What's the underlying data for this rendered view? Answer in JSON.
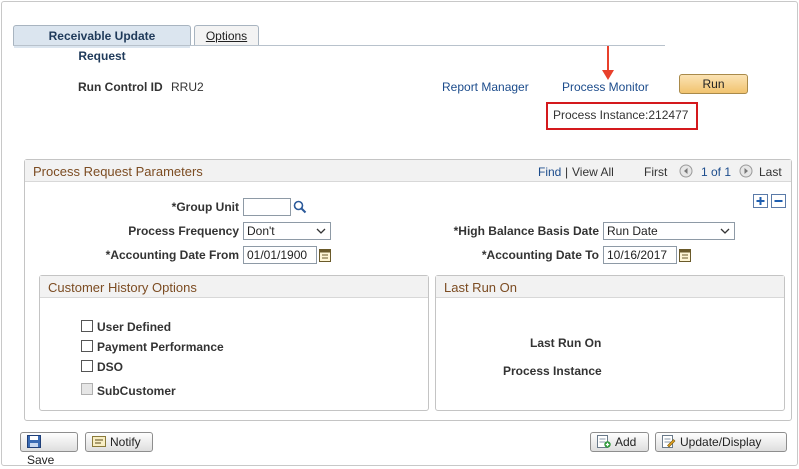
{
  "tabs": [
    {
      "label": "Receivable Update Request",
      "active": true
    },
    {
      "label": "Options",
      "active": false
    }
  ],
  "header": {
    "run_control_label": "Run Control ID",
    "run_control_value": "RRU2",
    "report_manager": "Report Manager",
    "process_monitor": "Process Monitor",
    "run_button": "Run",
    "process_instance": "Process Instance:212477"
  },
  "params": {
    "title": "Process Request Parameters",
    "find": "Find",
    "separator": "|",
    "view_all": "View All",
    "first": "First",
    "page_range": "1 of 1",
    "last": "Last",
    "group_unit_label": "*Group Unit",
    "group_unit_value": "",
    "process_frequency_label": "Process Frequency",
    "process_frequency_value": "Don't",
    "high_balance_label": "*High Balance Basis Date",
    "high_balance_value": "Run Date",
    "acct_date_from_label": "*Accounting Date From",
    "acct_date_from_value": "01/01/1900",
    "acct_date_to_label": "*Accounting Date To",
    "acct_date_to_value": "10/16/2017"
  },
  "customer_history": {
    "title": "Customer History Options",
    "options": [
      {
        "label": "User Defined",
        "checked": false,
        "disabled": false
      },
      {
        "label": "Payment Performance",
        "checked": false,
        "disabled": false
      },
      {
        "label": "DSO",
        "checked": false,
        "disabled": false
      },
      {
        "label": "SubCustomer",
        "checked": false,
        "disabled": true
      }
    ]
  },
  "last_run": {
    "title": "Last Run On",
    "last_run_on_label": "Last Run On",
    "process_instance_label": "Process Instance"
  },
  "footer": {
    "save": "Save",
    "notify": "Notify",
    "add": "Add",
    "update_display": "Update/Display"
  },
  "colors": {
    "accent_link": "#1c4c8c",
    "panel_title": "#7c4c22",
    "highlight_box": "#d4191d",
    "arrow": "#e8402b"
  }
}
